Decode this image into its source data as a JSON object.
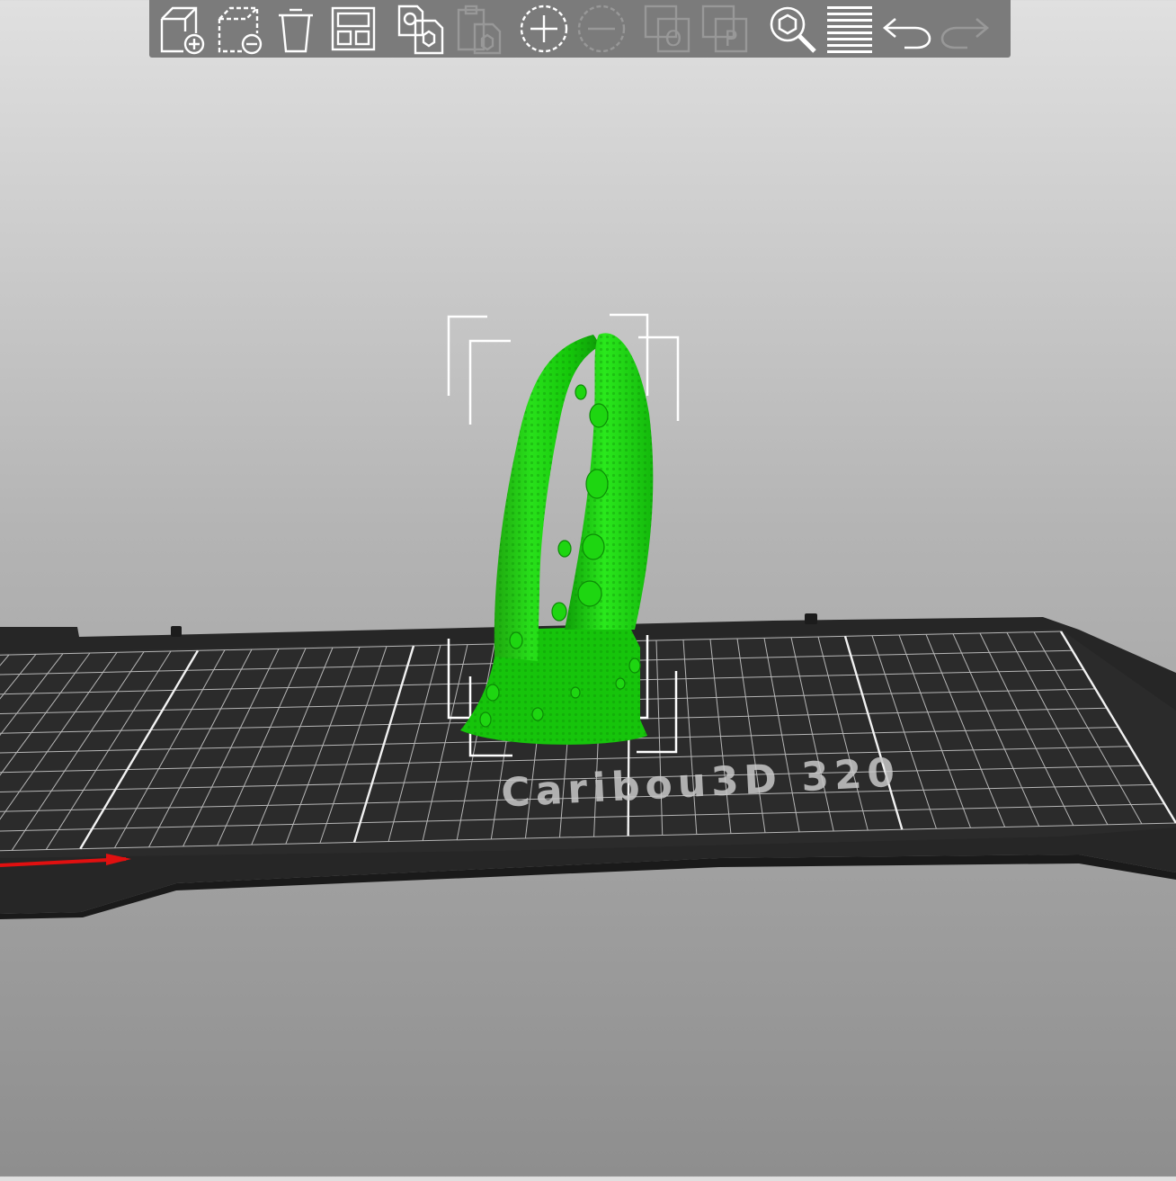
{
  "toolbar": {
    "buttons": [
      {
        "id": "add",
        "icon": "add-object-icon",
        "enabled": true
      },
      {
        "id": "delete",
        "icon": "delete-object-icon",
        "enabled": true
      },
      {
        "id": "delete-all",
        "icon": "trash-icon",
        "enabled": true
      },
      {
        "id": "arrange",
        "icon": "arrange-icon",
        "enabled": true
      },
      {
        "id": "copy",
        "icon": "copy-icon",
        "enabled": true
      },
      {
        "id": "paste",
        "icon": "paste-icon",
        "enabled": false
      },
      {
        "id": "add-instance",
        "icon": "add-instance-icon",
        "enabled": true
      },
      {
        "id": "remove-instance",
        "icon": "remove-instance-icon",
        "enabled": false
      },
      {
        "id": "split-objects",
        "icon": "split-objects-icon",
        "enabled": false
      },
      {
        "id": "split-parts",
        "icon": "split-parts-icon",
        "enabled": false
      },
      {
        "id": "search",
        "icon": "search-icon",
        "enabled": true
      },
      {
        "id": "layers",
        "icon": "layers-icon",
        "enabled": true
      },
      {
        "id": "undo",
        "icon": "undo-icon",
        "enabled": true
      },
      {
        "id": "redo",
        "icon": "redo-icon",
        "enabled": false
      }
    ]
  },
  "scene": {
    "bed_label": "Caribou3D 320",
    "model_color": "#00e600",
    "bed_color": "#262626",
    "grid_color": "#d8d8d8",
    "x_axis_color": "#e01010",
    "selection_box_color": "#ffffff"
  }
}
